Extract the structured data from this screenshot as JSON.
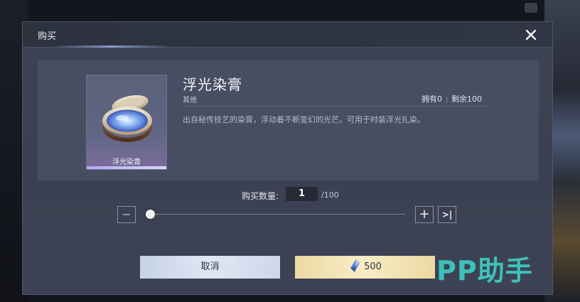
{
  "dialog": {
    "title": "购买",
    "close_icon": "close-icon"
  },
  "item": {
    "name": "浮光染膏",
    "card_label": "浮光染膏",
    "category": "其他",
    "owned_label": "拥有0",
    "remaining_label": "剩余100",
    "description": "出自秘传技艺的染膏，浮动着不断变幻的光芒。可用于时装浮光扎染。",
    "icon": "dye-compact-icon"
  },
  "quantity": {
    "label": "购买数量:",
    "value": "1",
    "max_label": "/100",
    "slider_fraction": 0.01
  },
  "controls": {
    "minus_symbol": "−",
    "plus_symbol": "+",
    "max_symbol": ">|"
  },
  "actions": {
    "cancel_label": "取消",
    "price": "500",
    "currency_icon": "crystal-gem-icon"
  },
  "watermark": {
    "text": "PP助手"
  },
  "colors": {
    "accent_gold": "#f8ecc6",
    "accent_blue": "#dfe7f4",
    "watermark": "#3fc8c0"
  }
}
